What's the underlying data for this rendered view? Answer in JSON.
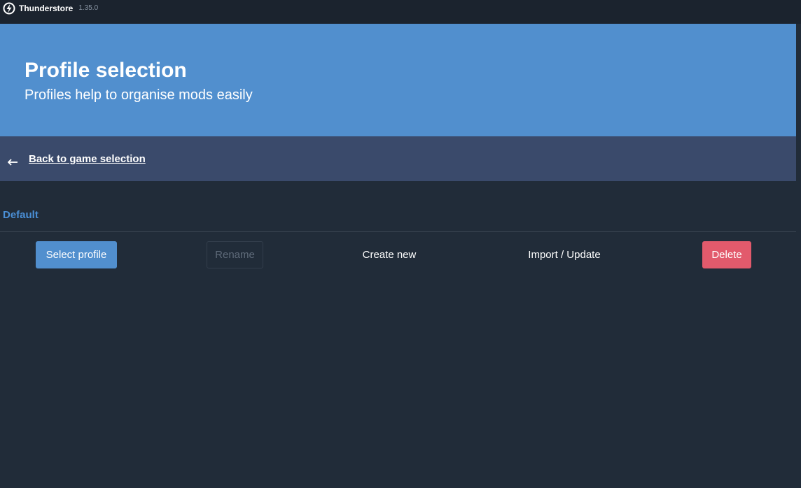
{
  "titlebar": {
    "app_name": "Thunderstore",
    "version": "1.35.0",
    "icon": "thunderstore-logo-icon"
  },
  "hero": {
    "title": "Profile selection",
    "subtitle": "Profiles help to organise mods easily"
  },
  "navigation": {
    "back_label": "Back to game selection",
    "back_icon": "arrow-left-icon"
  },
  "profile": {
    "name": "Default"
  },
  "actions": {
    "select_label": "Select profile",
    "rename_label": "Rename",
    "create_label": "Create new",
    "import_label": "Import / Update",
    "delete_label": "Delete"
  },
  "colors": {
    "hero_background": "#518fce",
    "back_bar_background": "#3a4a6b",
    "page_background": "#212c39",
    "primary_button": "#518fce",
    "danger_button": "#e25a6c",
    "profile_name": "#4a8fd6"
  }
}
